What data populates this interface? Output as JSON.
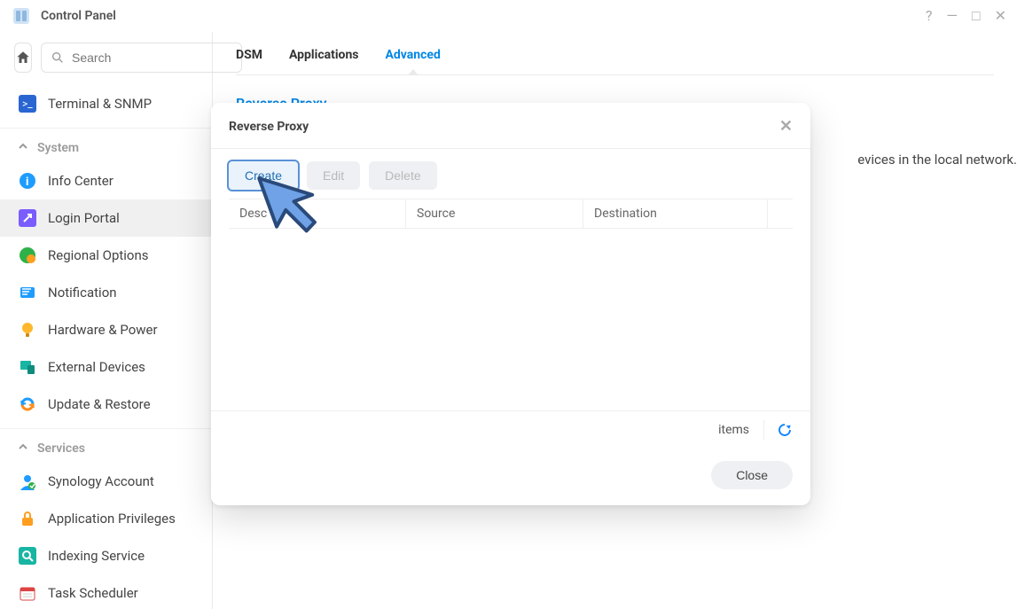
{
  "window": {
    "title": "Control Panel"
  },
  "search": {
    "placeholder": "Search"
  },
  "sidebar": {
    "pinned": [
      {
        "label": "Terminal & SNMP"
      }
    ],
    "groups": [
      {
        "label": "System",
        "items": [
          {
            "label": "Info Center"
          },
          {
            "label": "Login Portal",
            "active": true
          },
          {
            "label": "Regional Options"
          },
          {
            "label": "Notification"
          },
          {
            "label": "Hardware & Power"
          },
          {
            "label": "External Devices"
          },
          {
            "label": "Update & Restore"
          }
        ]
      },
      {
        "label": "Services",
        "items": [
          {
            "label": "Synology Account"
          },
          {
            "label": "Application Privileges"
          },
          {
            "label": "Indexing Service"
          },
          {
            "label": "Task Scheduler"
          }
        ]
      }
    ]
  },
  "tabs": [
    {
      "label": "DSM"
    },
    {
      "label": "Applications"
    },
    {
      "label": "Advanced",
      "active": true
    }
  ],
  "section": {
    "title": "Reverse Proxy"
  },
  "hint_tail": "evices in the local network.",
  "modal": {
    "title": "Reverse Proxy",
    "buttons": {
      "create": "Create",
      "edit": "Edit",
      "delete": "Delete"
    },
    "columns": {
      "c1_partial": "Desc",
      "c2": "Source",
      "c3": "Destination"
    },
    "status": {
      "items_label": "items"
    },
    "close": "Close"
  }
}
